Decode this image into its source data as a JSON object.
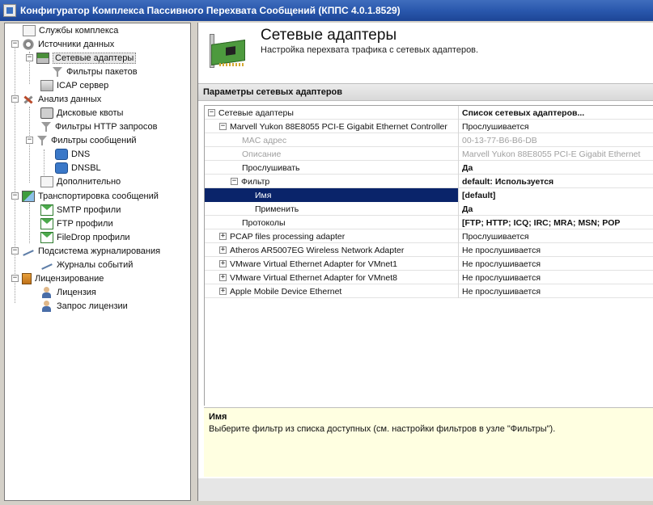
{
  "window": {
    "title": "Конфигуратор Комплекса Пассивного Перехвата Сообщений (КППС 4.0.1.8529)"
  },
  "tree": {
    "items": [
      {
        "label": "Службы комплекса",
        "icon": "wrench-doc-icon"
      },
      {
        "label": "Источники данных",
        "icon": "gear-icon",
        "expander": "−"
      },
      {
        "label": "Сетевые адаптеры",
        "icon": "network-card-icon",
        "expander": "−",
        "selected": true
      },
      {
        "label": "Фильтры пакетов",
        "icon": "funnel-icon"
      },
      {
        "label": "ICAP сервер",
        "icon": "server-icon"
      },
      {
        "label": "Анализ данных",
        "icon": "tools-icon",
        "expander": "−"
      },
      {
        "label": "Дисковые квоты",
        "icon": "disk-icon"
      },
      {
        "label": "Фильтры HTTP запросов",
        "icon": "funnel-icon"
      },
      {
        "label": "Фильтры сообщений",
        "icon": "funnel-icon",
        "expander": "−"
      },
      {
        "label": "DNS",
        "icon": "network-icon"
      },
      {
        "label": "DNSBL",
        "icon": "network-icon"
      },
      {
        "label": "Дополнительно",
        "icon": "document-icon"
      },
      {
        "label": "Транспортировка сообщений",
        "icon": "transport-icon",
        "expander": "−"
      },
      {
        "label": "SMTP профили",
        "icon": "mail-icon"
      },
      {
        "label": "FTP профили",
        "icon": "mail-icon"
      },
      {
        "label": "FileDrop профили",
        "icon": "mail-icon"
      },
      {
        "label": "Подсистема журналирования",
        "icon": "log-icon",
        "expander": "−"
      },
      {
        "label": "Журналы событий",
        "icon": "log-icon"
      },
      {
        "label": "Лицензирование",
        "icon": "license-icon",
        "expander": "−"
      },
      {
        "label": "Лицензия",
        "icon": "person-icon"
      },
      {
        "label": "Запрос лицензии",
        "icon": "person-icon"
      }
    ]
  },
  "header": {
    "title": "Сетевые адаптеры",
    "subtitle": "Настройка перехвата трафика с сетевых адаптеров.",
    "image": "network-card-icon"
  },
  "section": {
    "title": "Параметры сетевых адаптеров"
  },
  "grid": {
    "rows": [
      {
        "name": "Сетевые адаптеры",
        "value": "Список сетевых адаптеров...",
        "expander": "−",
        "value_bold": true
      },
      {
        "name": "Marvell Yukon 88E8055 PCI-E Gigabit Ethernet Controller",
        "value": "Прослушивается",
        "expander": "−"
      },
      {
        "name": "MAC адрес",
        "value": "00-13-77-B6-B6-DB",
        "grey": true
      },
      {
        "name": "Описание",
        "value": "Marvell Yukon 88E8055 PCI-E Gigabit Ethernet",
        "grey": true
      },
      {
        "name": "Прослушивать",
        "value": "Да",
        "value_bold": true
      },
      {
        "name": "Фильтр",
        "value": "default: Используется",
        "expander": "−",
        "value_bold": true
      },
      {
        "name": "Имя",
        "value": "[default]",
        "selected": true,
        "value_bold": true
      },
      {
        "name": "Применить",
        "value": "Да",
        "value_bold": true
      },
      {
        "name": "Протоколы",
        "value": "[FTP; HTTP; ICQ; IRC; MRA; MSN; POP",
        "value_bold": true
      },
      {
        "name": "PCAP files processing adapter",
        "value": "Прослушивается",
        "expander": "+"
      },
      {
        "name": "Atheros AR5007EG Wireless Network Adapter",
        "value": "Не прослушивается",
        "expander": "+"
      },
      {
        "name": "VMware Virtual Ethernet Adapter for VMnet1",
        "value": "Не прослушивается",
        "expander": "+"
      },
      {
        "name": "VMware Virtual Ethernet Adapter for VMnet8",
        "value": "Не прослушивается",
        "expander": "+"
      },
      {
        "name": "Apple Mobile Device Ethernet",
        "value": "Не прослушивается",
        "expander": "+"
      }
    ]
  },
  "description": {
    "title": "Имя",
    "text": "Выберите фильтр из списка доступных (см. настройки фильтров в узле \"Фильтры\")."
  }
}
